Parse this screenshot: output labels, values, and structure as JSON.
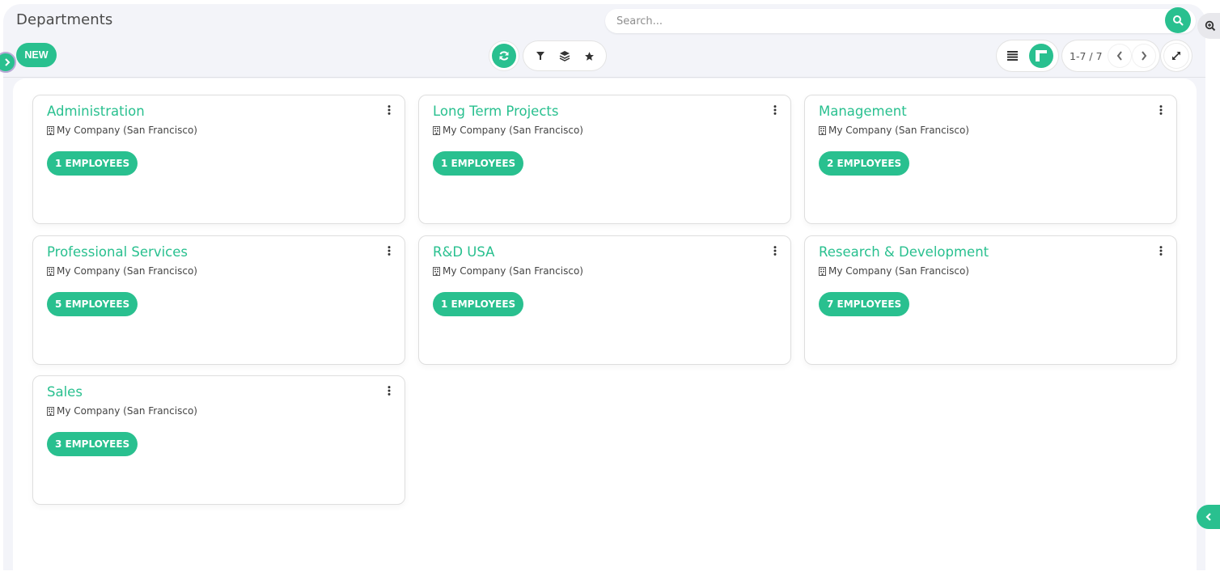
{
  "header": {
    "title": "Departments",
    "new_label": "NEW"
  },
  "search": {
    "placeholder": "Search...",
    "value": ""
  },
  "toolbar": {
    "icons": [
      "refresh-icon",
      "filter-icon",
      "group-by-icon",
      "favorites-icon"
    ]
  },
  "views": {
    "list_icon": "list-view-icon",
    "kanban_icon": "kanban-view-icon",
    "active": "kanban"
  },
  "pager": {
    "text": "1-7 / 7"
  },
  "colors": {
    "accent": "#29c08f",
    "background": "#f3f4f9"
  },
  "cards": [
    {
      "name": "Administration",
      "company": "My Company (San Francisco)",
      "employees": "1 EMPLOYEES"
    },
    {
      "name": "Long Term Projects",
      "company": "My Company (San Francisco)",
      "employees": "1 EMPLOYEES"
    },
    {
      "name": "Management",
      "company": "My Company (San Francisco)",
      "employees": "2 EMPLOYEES"
    },
    {
      "name": "Professional Services",
      "company": "My Company (San Francisco)",
      "employees": "5 EMPLOYEES"
    },
    {
      "name": "R&D USA",
      "company": "My Company (San Francisco)",
      "employees": "1 EMPLOYEES"
    },
    {
      "name": "Research & Development",
      "company": "My Company (San Francisco)",
      "employees": "7 EMPLOYEES"
    },
    {
      "name": "Sales",
      "company": "My Company (San Francisco)",
      "employees": "3 EMPLOYEES"
    }
  ]
}
